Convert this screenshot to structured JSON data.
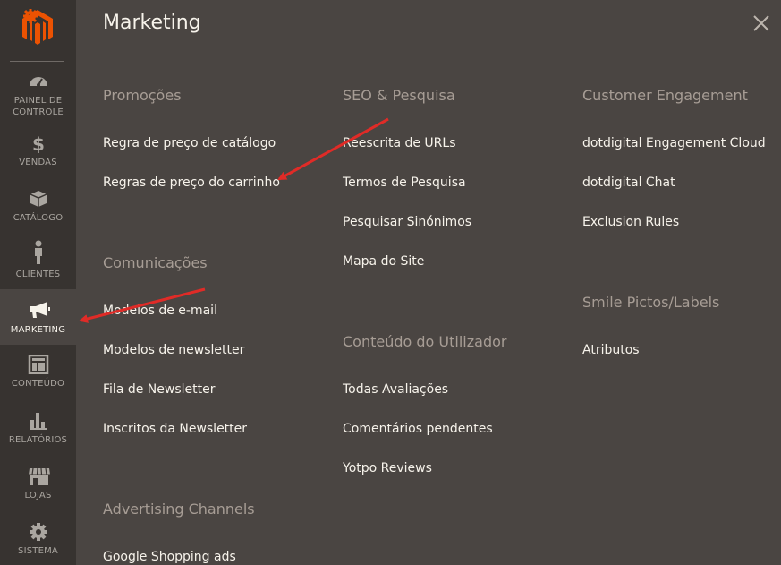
{
  "sidebar": {
    "items": [
      {
        "label_line1": "PAINEL DE",
        "label_line2": "CONTROLE",
        "icon": "dashboard-icon"
      },
      {
        "label": "VENDAS",
        "icon": "dollar-icon"
      },
      {
        "label": "CATÁLOGO",
        "icon": "cube-icon"
      },
      {
        "label": "CLIENTES",
        "icon": "person-icon"
      },
      {
        "label": "MARKETING",
        "icon": "megaphone-icon"
      },
      {
        "label": "CONTEÚDO",
        "icon": "layout-icon"
      },
      {
        "label": "RELATÓRIOS",
        "icon": "bar-chart-icon"
      },
      {
        "label": "LOJAS",
        "icon": "store-icon"
      },
      {
        "label": "SISTEMA",
        "icon": "gear-icon"
      }
    ]
  },
  "panel": {
    "title": "Marketing",
    "sections": {
      "promocoes": {
        "title": "Promoções",
        "links": [
          "Regra de preço de catálogo",
          "Regras de preço do carrinho"
        ]
      },
      "comunicacoes": {
        "title": "Comunicações",
        "links": [
          "Modelos de e-mail",
          "Modelos de newsletter",
          "Fila de Newsletter",
          "Inscritos da Newsletter"
        ]
      },
      "advertising": {
        "title": "Advertising Channels",
        "links": [
          "Google Shopping ads"
        ]
      },
      "seo": {
        "title": "SEO & Pesquisa",
        "links": [
          "Reescrita de URLs",
          "Termos de Pesquisa",
          "Pesquisar Sinónimos",
          "Mapa do Site"
        ]
      },
      "conteudo": {
        "title": "Conteúdo do Utilizador",
        "links": [
          "Todas Avaliações",
          "Comentários pendentes",
          "Yotpo Reviews"
        ]
      },
      "customer": {
        "title": "Customer Engagement",
        "links": [
          "dotdigital Engagement Cloud",
          "dotdigital Chat",
          "Exclusion Rules"
        ]
      },
      "smile": {
        "title": "Smile Pictos/Labels",
        "links": [
          "Atributos"
        ]
      }
    }
  },
  "colors": {
    "sidebar_bg": "#373330",
    "panel_bg": "#4a4542",
    "logo_orange": "#eb5202",
    "annotation_red": "#e02b27"
  }
}
